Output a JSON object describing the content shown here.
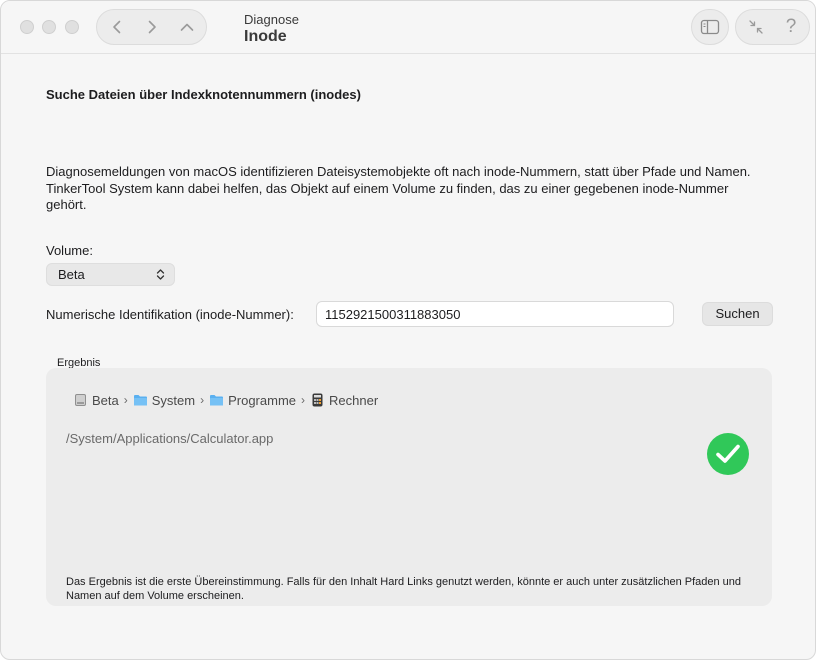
{
  "toolbar": {
    "section": "Diagnose",
    "title": "Inode",
    "help_label": "?"
  },
  "main": {
    "heading": "Suche Dateien über Indexknotennummern (inodes)",
    "description": "Diagnosemeldungen von macOS identifizieren Dateisystemobjekte oft nach inode-Nummern, statt über Pfade und Namen. TinkerTool System kann dabei helfen, das Objekt auf einem Volume zu finden, das zu einer gegebenen inode-Nummer gehört.",
    "volume_label": "Volume:",
    "volume_value": "Beta",
    "inode_label": "Numerische Identifikation (inode-Nummer):",
    "inode_value": "1152921500311883050",
    "search_button": "Suchen"
  },
  "result": {
    "label": "Ergebnis",
    "path_components": [
      "Beta",
      "System",
      "Programme",
      "Rechner"
    ],
    "separator": "›",
    "path": "/System/Applications/Calculator.app",
    "note": "Das Ergebnis ist die erste Übereinstimmung. Falls für den Inhalt Hard Links genutzt werden, könnte er auch unter zusätzlichen Pfaden und Namen auf dem Volume erscheinen.",
    "success_color": "#30c859"
  }
}
